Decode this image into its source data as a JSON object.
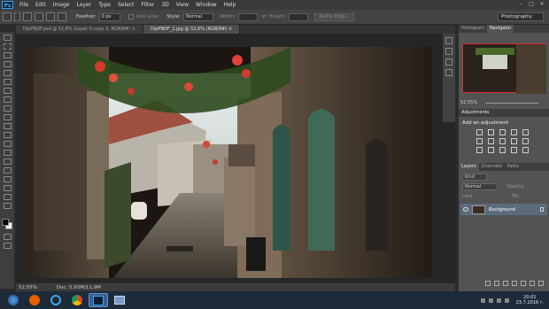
{
  "app": {
    "logo": "Ps"
  },
  "menubar": {
    "items": [
      "File",
      "Edit",
      "Image",
      "Layer",
      "Type",
      "Select",
      "Filter",
      "3D",
      "View",
      "Window",
      "Help"
    ]
  },
  "window_controls": {
    "minimize": "–",
    "maximize": "□",
    "close": "✕"
  },
  "options": {
    "feather_label": "Feather:",
    "feather_value": "0 px",
    "antialias_label": "Anti-alias",
    "style_label": "Style:",
    "style_value": "Normal",
    "width_label": "Width:",
    "height_label": "Height:",
    "refine_edge": "Refine Edge...",
    "workspace": "Photography"
  },
  "tabs": [
    {
      "label": "DipPNDF.psd @ 52,6% (Layer 0 copy 3, RGB/8#) ×",
      "active": false
    },
    {
      "label": "DipPNDF_2.jpg @ 52,6% (RGB/8#) ×",
      "active": true
    }
  ],
  "status": {
    "zoom": "52,55%",
    "doc": "Doc: 5,93M/11,9M"
  },
  "panels": {
    "histogram_tab": "Histogram",
    "navigator_tab": "Navigator",
    "nav_zoom": "52,55%",
    "adjustments_title": "Adjustments",
    "adjustments_subtitle": "Add an adjustment",
    "layers_tab": "Layers",
    "channels_tab": "Channels",
    "paths_tab": "Paths",
    "kind_label": "Kind",
    "blend_mode": "Normal",
    "opacity_label": "Opacity:",
    "fill_label": "Fill:",
    "lock_label": "Lock:",
    "layer_name": "Background"
  },
  "taskbar": {
    "time": "20:01",
    "date": "23.7.2016 г."
  }
}
